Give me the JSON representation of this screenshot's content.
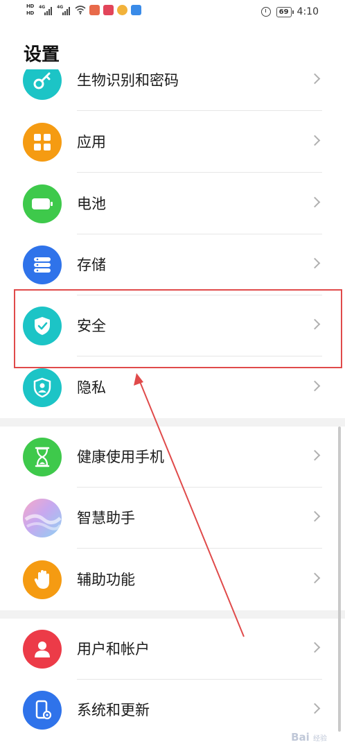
{
  "status_bar": {
    "hd_top": "HD",
    "hd_bottom": "HD",
    "net1": "4G",
    "net2": "4G",
    "battery": "69",
    "time": "4:10"
  },
  "page": {
    "title": "设置"
  },
  "items": [
    {
      "label": "生物识别和密码",
      "icon": "key-icon",
      "color": "#1cc4c6"
    },
    {
      "label": "应用",
      "icon": "apps-grid-icon",
      "color": "#f59b12"
    },
    {
      "label": "电池",
      "icon": "battery-icon",
      "color": "#3ec94b"
    },
    {
      "label": "存储",
      "icon": "storage-icon",
      "color": "#2f73ea"
    },
    {
      "label": "安全",
      "icon": "shield-check-icon",
      "color": "#1cc4c6"
    },
    {
      "label": "隐私",
      "icon": "privacy-icon",
      "color": "#1cc4c6"
    },
    {
      "label": "健康使用手机",
      "icon": "hourglass-icon",
      "color": "#3ec94b"
    },
    {
      "label": "智慧助手",
      "icon": "assistant-icon",
      "color": "#c7a8ef"
    },
    {
      "label": "辅助功能",
      "icon": "hand-icon",
      "color": "#f59b12"
    },
    {
      "label": "用户和帐户",
      "icon": "user-icon",
      "color": "#ec3b48"
    },
    {
      "label": "系统和更新",
      "icon": "system-update-icon",
      "color": "#2f73ea"
    }
  ],
  "annotation": {
    "highlight_color": "#e04a4a"
  },
  "watermark": {
    "text": "Bai",
    "sub": "经验"
  }
}
